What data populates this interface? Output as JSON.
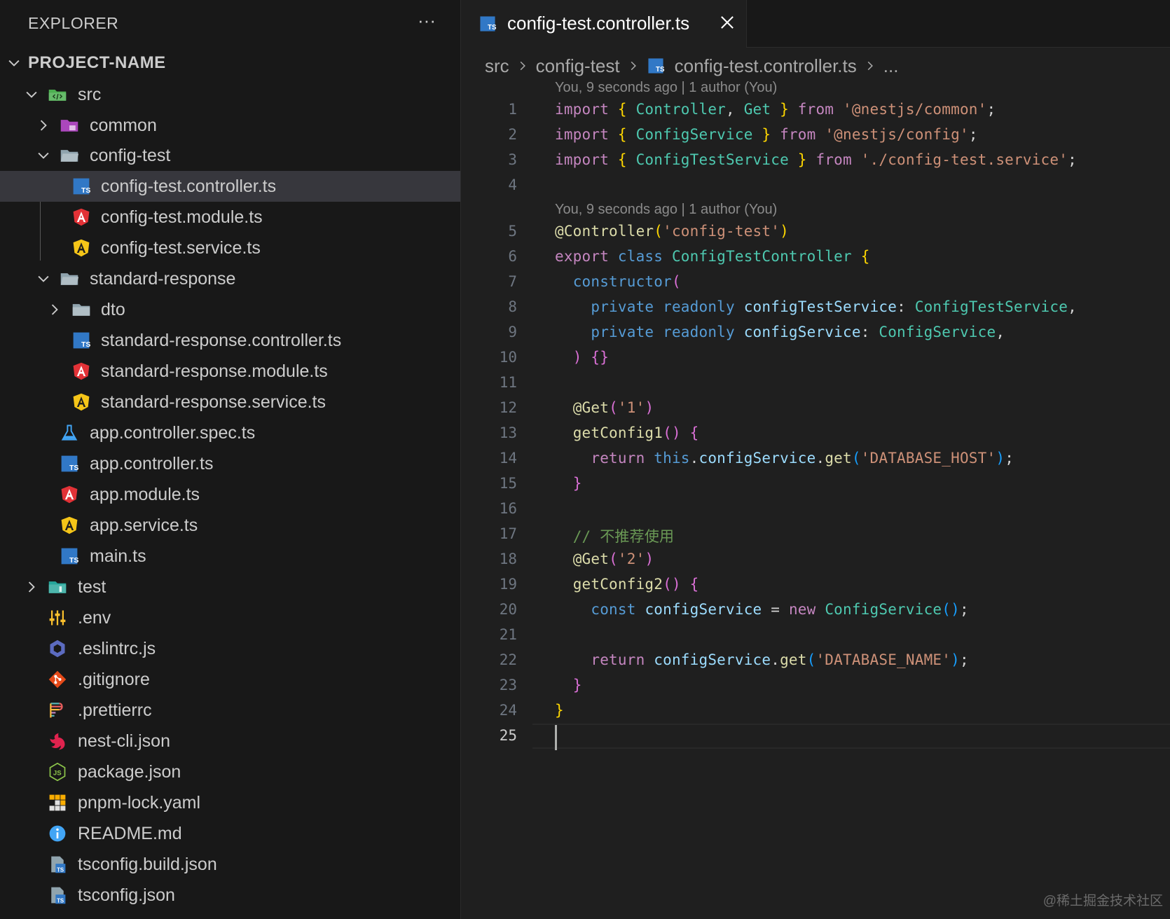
{
  "sidebar": {
    "title": "EXPLORER",
    "more_actions": "···",
    "root": "PROJECT-NAME",
    "items": [
      {
        "label": "src"
      },
      {
        "label": "common"
      },
      {
        "label": "config-test"
      },
      {
        "label": "config-test.controller.ts"
      },
      {
        "label": "config-test.module.ts"
      },
      {
        "label": "config-test.service.ts"
      },
      {
        "label": "standard-response"
      },
      {
        "label": "dto"
      },
      {
        "label": "standard-response.controller.ts"
      },
      {
        "label": "standard-response.module.ts"
      },
      {
        "label": "standard-response.service.ts"
      },
      {
        "label": "app.controller.spec.ts"
      },
      {
        "label": "app.controller.ts"
      },
      {
        "label": "app.module.ts"
      },
      {
        "label": "app.service.ts"
      },
      {
        "label": "main.ts"
      },
      {
        "label": "test"
      },
      {
        "label": ".env"
      },
      {
        "label": ".eslintrc.js"
      },
      {
        "label": ".gitignore"
      },
      {
        "label": ".prettierrc"
      },
      {
        "label": "nest-cli.json"
      },
      {
        "label": "package.json"
      },
      {
        "label": "pnpm-lock.yaml"
      },
      {
        "label": "README.md"
      },
      {
        "label": "tsconfig.build.json"
      },
      {
        "label": "tsconfig.json"
      }
    ]
  },
  "editor": {
    "tab_label": "config-test.controller.ts",
    "breadcrumb": [
      "src",
      "config-test",
      "config-test.controller.ts",
      "..."
    ],
    "blame": "You, 9 seconds ago | 1 author (You)",
    "line_numbers": [
      "1",
      "2",
      "3",
      "4",
      "5",
      "6",
      "7",
      "8",
      "9",
      "10",
      "11",
      "12",
      "13",
      "14",
      "15",
      "16",
      "17",
      "18",
      "19",
      "20",
      "21",
      "22",
      "23",
      "24",
      "25"
    ],
    "lines": [
      "import { Controller, Get } from '@nestjs/common';",
      "import { ConfigService } from '@nestjs/config';",
      "import { ConfigTestService } from './config-test.service';",
      "",
      "@Controller('config-test')",
      "export class ConfigTestController {",
      "  constructor(",
      "    private readonly configTestService: ConfigTestService,",
      "    private readonly configService: ConfigService,",
      "  ) {}",
      "",
      "  @Get('1')",
      "  getConfig1() {",
      "    return this.configService.get('DATABASE_HOST');",
      "  }",
      "",
      "  // 不推荐使用",
      "  @Get('2')",
      "  getConfig2() {",
      "    const configService = new ConfigService();",
      "",
      "    return configService.get('DATABASE_NAME');",
      "  }",
      "}",
      ""
    ]
  },
  "watermark": "@稀土掘金技术社区",
  "colors": {
    "sidebar_bg": "#181818",
    "editor_bg": "#1f1f1f",
    "selection_bg": "#37373d",
    "ts_blue": "#3178c6",
    "angular_red": "#e23237",
    "angular_yellow": "#f5c518"
  }
}
